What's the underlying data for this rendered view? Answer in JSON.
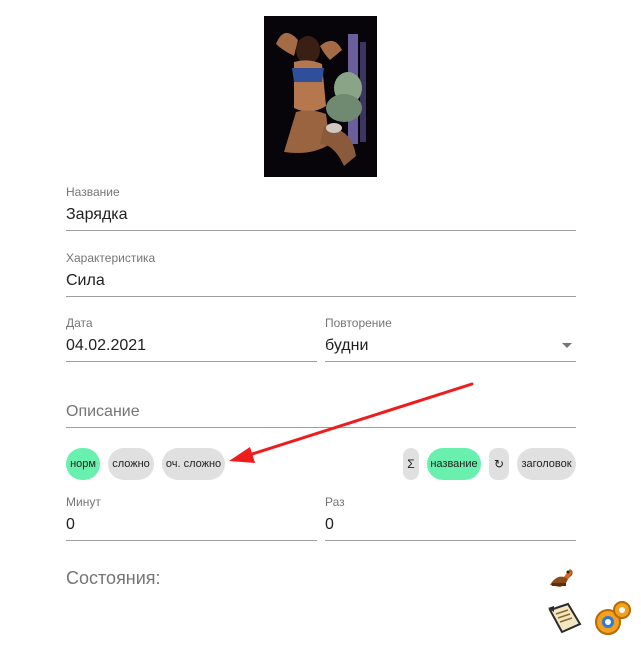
{
  "form": {
    "name": {
      "label": "Название",
      "value": "Зарядка"
    },
    "characteristic": {
      "label": "Характеристика",
      "value": "Сила"
    },
    "date": {
      "label": "Дата",
      "value": "04.02.2021"
    },
    "repeat": {
      "label": "Повторение",
      "value": "будни"
    },
    "description": {
      "placeholder": "Описание"
    },
    "minutes": {
      "label": "Минут",
      "value": "0"
    },
    "times": {
      "label": "Раз",
      "value": "0"
    }
  },
  "difficulty_chips": [
    {
      "label": "норм",
      "active": true
    },
    {
      "label": "сложно",
      "active": false
    },
    {
      "label": "оч. сложно",
      "active": false
    }
  ],
  "sort_chips": {
    "sum_symbol": "Σ",
    "name_label": "название",
    "refresh_symbol": "↻",
    "header_label": "заголовок"
  },
  "states": {
    "title": "Состояния:"
  },
  "colors": {
    "accent_chip": "#69f0ae",
    "chip": "#e0e0e0",
    "annotation_arrow": "#ee1c1c"
  },
  "icons": [
    "hero-image",
    "dropdown-arrow-icon",
    "horse-icon",
    "scroll-icon",
    "gears-icon"
  ]
}
